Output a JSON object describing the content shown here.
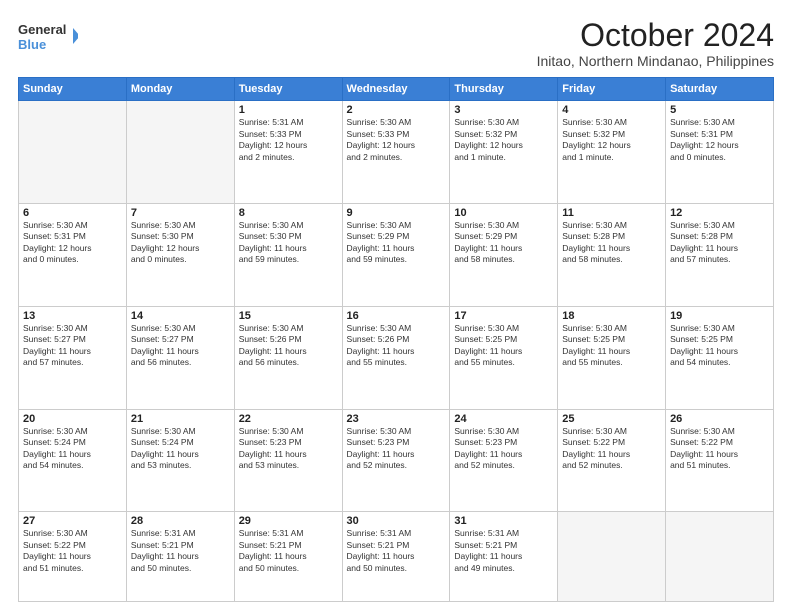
{
  "header": {
    "logo_line1": "General",
    "logo_line2": "Blue",
    "title": "October 2024",
    "subtitle": "Initao, Northern Mindanao, Philippines"
  },
  "days_of_week": [
    "Sunday",
    "Monday",
    "Tuesday",
    "Wednesday",
    "Thursday",
    "Friday",
    "Saturday"
  ],
  "weeks": [
    [
      {
        "day": "",
        "empty": true
      },
      {
        "day": "",
        "empty": true
      },
      {
        "day": "1",
        "info": "Sunrise: 5:31 AM\nSunset: 5:33 PM\nDaylight: 12 hours\nand 2 minutes."
      },
      {
        "day": "2",
        "info": "Sunrise: 5:30 AM\nSunset: 5:33 PM\nDaylight: 12 hours\nand 2 minutes."
      },
      {
        "day": "3",
        "info": "Sunrise: 5:30 AM\nSunset: 5:32 PM\nDaylight: 12 hours\nand 1 minute."
      },
      {
        "day": "4",
        "info": "Sunrise: 5:30 AM\nSunset: 5:32 PM\nDaylight: 12 hours\nand 1 minute."
      },
      {
        "day": "5",
        "info": "Sunrise: 5:30 AM\nSunset: 5:31 PM\nDaylight: 12 hours\nand 0 minutes."
      }
    ],
    [
      {
        "day": "6",
        "info": "Sunrise: 5:30 AM\nSunset: 5:31 PM\nDaylight: 12 hours\nand 0 minutes."
      },
      {
        "day": "7",
        "info": "Sunrise: 5:30 AM\nSunset: 5:30 PM\nDaylight: 12 hours\nand 0 minutes."
      },
      {
        "day": "8",
        "info": "Sunrise: 5:30 AM\nSunset: 5:30 PM\nDaylight: 11 hours\nand 59 minutes."
      },
      {
        "day": "9",
        "info": "Sunrise: 5:30 AM\nSunset: 5:29 PM\nDaylight: 11 hours\nand 59 minutes."
      },
      {
        "day": "10",
        "info": "Sunrise: 5:30 AM\nSunset: 5:29 PM\nDaylight: 11 hours\nand 58 minutes."
      },
      {
        "day": "11",
        "info": "Sunrise: 5:30 AM\nSunset: 5:28 PM\nDaylight: 11 hours\nand 58 minutes."
      },
      {
        "day": "12",
        "info": "Sunrise: 5:30 AM\nSunset: 5:28 PM\nDaylight: 11 hours\nand 57 minutes."
      }
    ],
    [
      {
        "day": "13",
        "info": "Sunrise: 5:30 AM\nSunset: 5:27 PM\nDaylight: 11 hours\nand 57 minutes."
      },
      {
        "day": "14",
        "info": "Sunrise: 5:30 AM\nSunset: 5:27 PM\nDaylight: 11 hours\nand 56 minutes."
      },
      {
        "day": "15",
        "info": "Sunrise: 5:30 AM\nSunset: 5:26 PM\nDaylight: 11 hours\nand 56 minutes."
      },
      {
        "day": "16",
        "info": "Sunrise: 5:30 AM\nSunset: 5:26 PM\nDaylight: 11 hours\nand 55 minutes."
      },
      {
        "day": "17",
        "info": "Sunrise: 5:30 AM\nSunset: 5:25 PM\nDaylight: 11 hours\nand 55 minutes."
      },
      {
        "day": "18",
        "info": "Sunrise: 5:30 AM\nSunset: 5:25 PM\nDaylight: 11 hours\nand 55 minutes."
      },
      {
        "day": "19",
        "info": "Sunrise: 5:30 AM\nSunset: 5:25 PM\nDaylight: 11 hours\nand 54 minutes."
      }
    ],
    [
      {
        "day": "20",
        "info": "Sunrise: 5:30 AM\nSunset: 5:24 PM\nDaylight: 11 hours\nand 54 minutes."
      },
      {
        "day": "21",
        "info": "Sunrise: 5:30 AM\nSunset: 5:24 PM\nDaylight: 11 hours\nand 53 minutes."
      },
      {
        "day": "22",
        "info": "Sunrise: 5:30 AM\nSunset: 5:23 PM\nDaylight: 11 hours\nand 53 minutes."
      },
      {
        "day": "23",
        "info": "Sunrise: 5:30 AM\nSunset: 5:23 PM\nDaylight: 11 hours\nand 52 minutes."
      },
      {
        "day": "24",
        "info": "Sunrise: 5:30 AM\nSunset: 5:23 PM\nDaylight: 11 hours\nand 52 minutes."
      },
      {
        "day": "25",
        "info": "Sunrise: 5:30 AM\nSunset: 5:22 PM\nDaylight: 11 hours\nand 52 minutes."
      },
      {
        "day": "26",
        "info": "Sunrise: 5:30 AM\nSunset: 5:22 PM\nDaylight: 11 hours\nand 51 minutes."
      }
    ],
    [
      {
        "day": "27",
        "info": "Sunrise: 5:30 AM\nSunset: 5:22 PM\nDaylight: 11 hours\nand 51 minutes."
      },
      {
        "day": "28",
        "info": "Sunrise: 5:31 AM\nSunset: 5:21 PM\nDaylight: 11 hours\nand 50 minutes."
      },
      {
        "day": "29",
        "info": "Sunrise: 5:31 AM\nSunset: 5:21 PM\nDaylight: 11 hours\nand 50 minutes."
      },
      {
        "day": "30",
        "info": "Sunrise: 5:31 AM\nSunset: 5:21 PM\nDaylight: 11 hours\nand 50 minutes."
      },
      {
        "day": "31",
        "info": "Sunrise: 5:31 AM\nSunset: 5:21 PM\nDaylight: 11 hours\nand 49 minutes."
      },
      {
        "day": "",
        "empty": true
      },
      {
        "day": "",
        "empty": true
      }
    ]
  ]
}
